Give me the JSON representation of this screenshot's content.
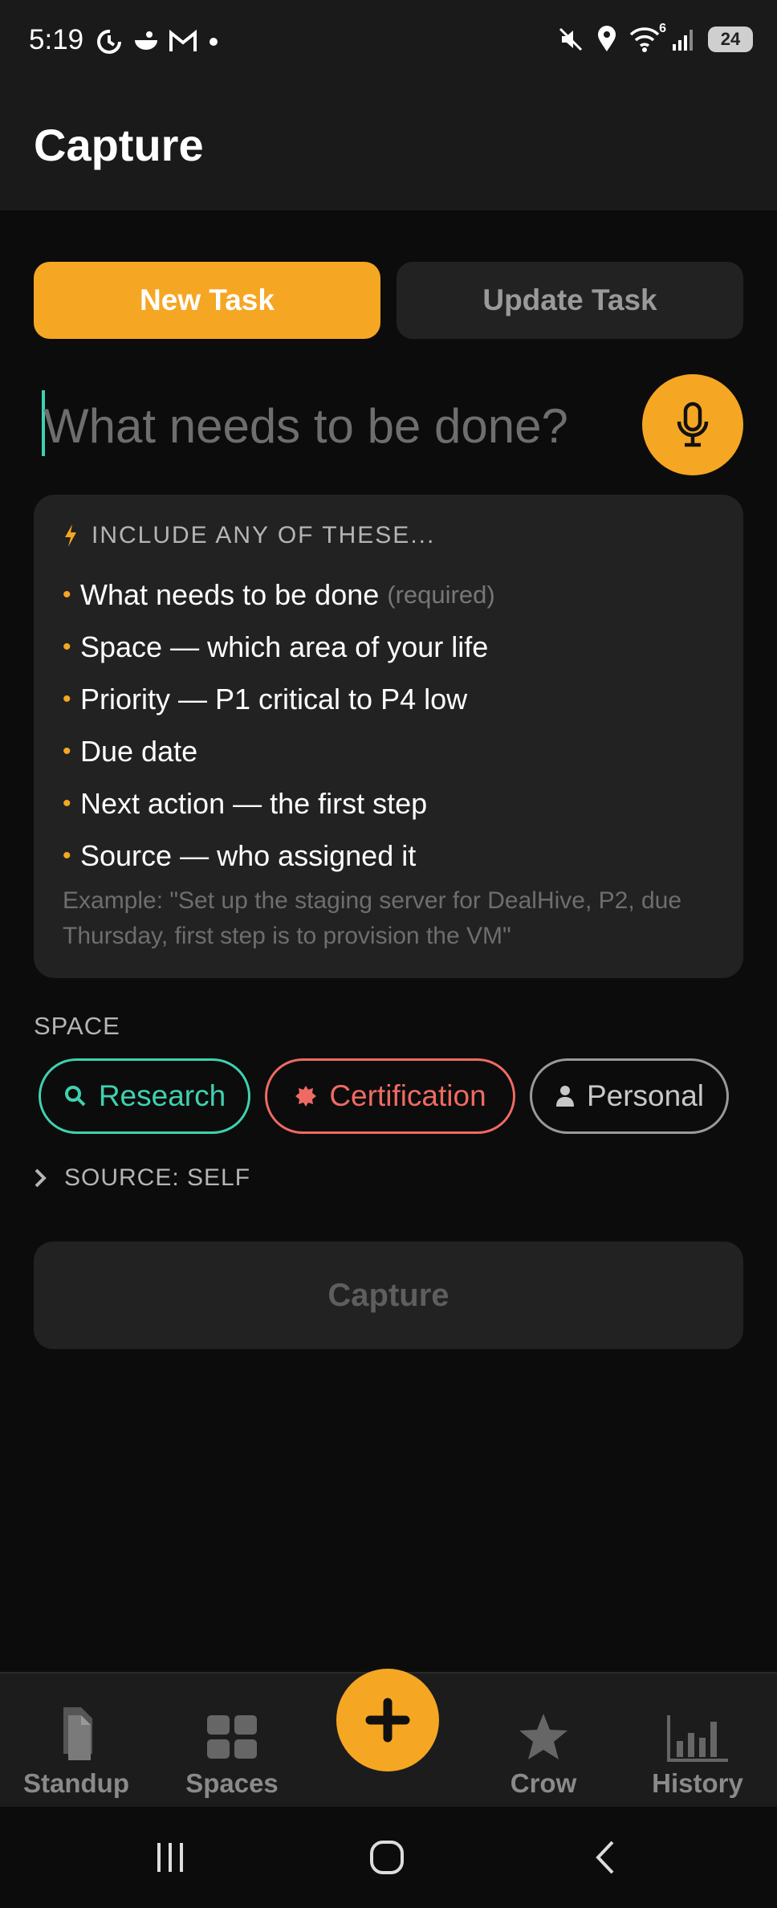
{
  "status_bar": {
    "time": "5:19",
    "left_icons": [
      "sync-icon",
      "bowl-icon",
      "gmail-icon",
      "dot-icon"
    ],
    "right_icons": [
      "mute-icon",
      "location-icon",
      "wifi-icon",
      "signal-icon"
    ],
    "wifi_badge": "6",
    "battery": "24"
  },
  "header": {
    "title": "Capture"
  },
  "tabs": [
    {
      "label": "New Task",
      "active": true
    },
    {
      "label": "Update Task",
      "active": false
    }
  ],
  "task_input": {
    "placeholder": "What needs to be done?",
    "value": ""
  },
  "hints": {
    "heading": "INCLUDE ANY OF THESE...",
    "items": [
      {
        "text": "What needs to be done",
        "note": "(required)"
      },
      {
        "text": "Space — which area of your life"
      },
      {
        "text": "Priority — P1 critical to P4 low"
      },
      {
        "text": "Due date"
      },
      {
        "text": "Next action — the first step"
      },
      {
        "text": "Source — who assigned it"
      }
    ],
    "example": "Example: \"Set up the staging server for DealHive, P2, due Thursday, first step is to provision the VM\""
  },
  "space": {
    "label": "SPACE",
    "chips": [
      {
        "label": "Research",
        "icon": "search-icon",
        "color": "#3fd1b0"
      },
      {
        "label": "Certification",
        "icon": "badge-icon",
        "color": "#ef6a63"
      },
      {
        "label": "Personal",
        "icon": "person-icon",
        "color": "#c8c8c8"
      }
    ]
  },
  "source": {
    "label": "SOURCE: SELF"
  },
  "capture_button": {
    "label": "Capture"
  },
  "bottom_nav": {
    "items": [
      {
        "label": "Standup",
        "icon": "document-icon"
      },
      {
        "label": "Spaces",
        "icon": "grid-icon"
      },
      {
        "label": "Crow",
        "icon": "star-icon"
      },
      {
        "label": "History",
        "icon": "bar-chart-icon"
      }
    ],
    "fab_icon": "plus-icon"
  },
  "colors": {
    "accent": "#f5a623",
    "research": "#3fd1b0",
    "certification": "#ef6a63",
    "background": "#0c0c0c",
    "surface": "#222222"
  }
}
